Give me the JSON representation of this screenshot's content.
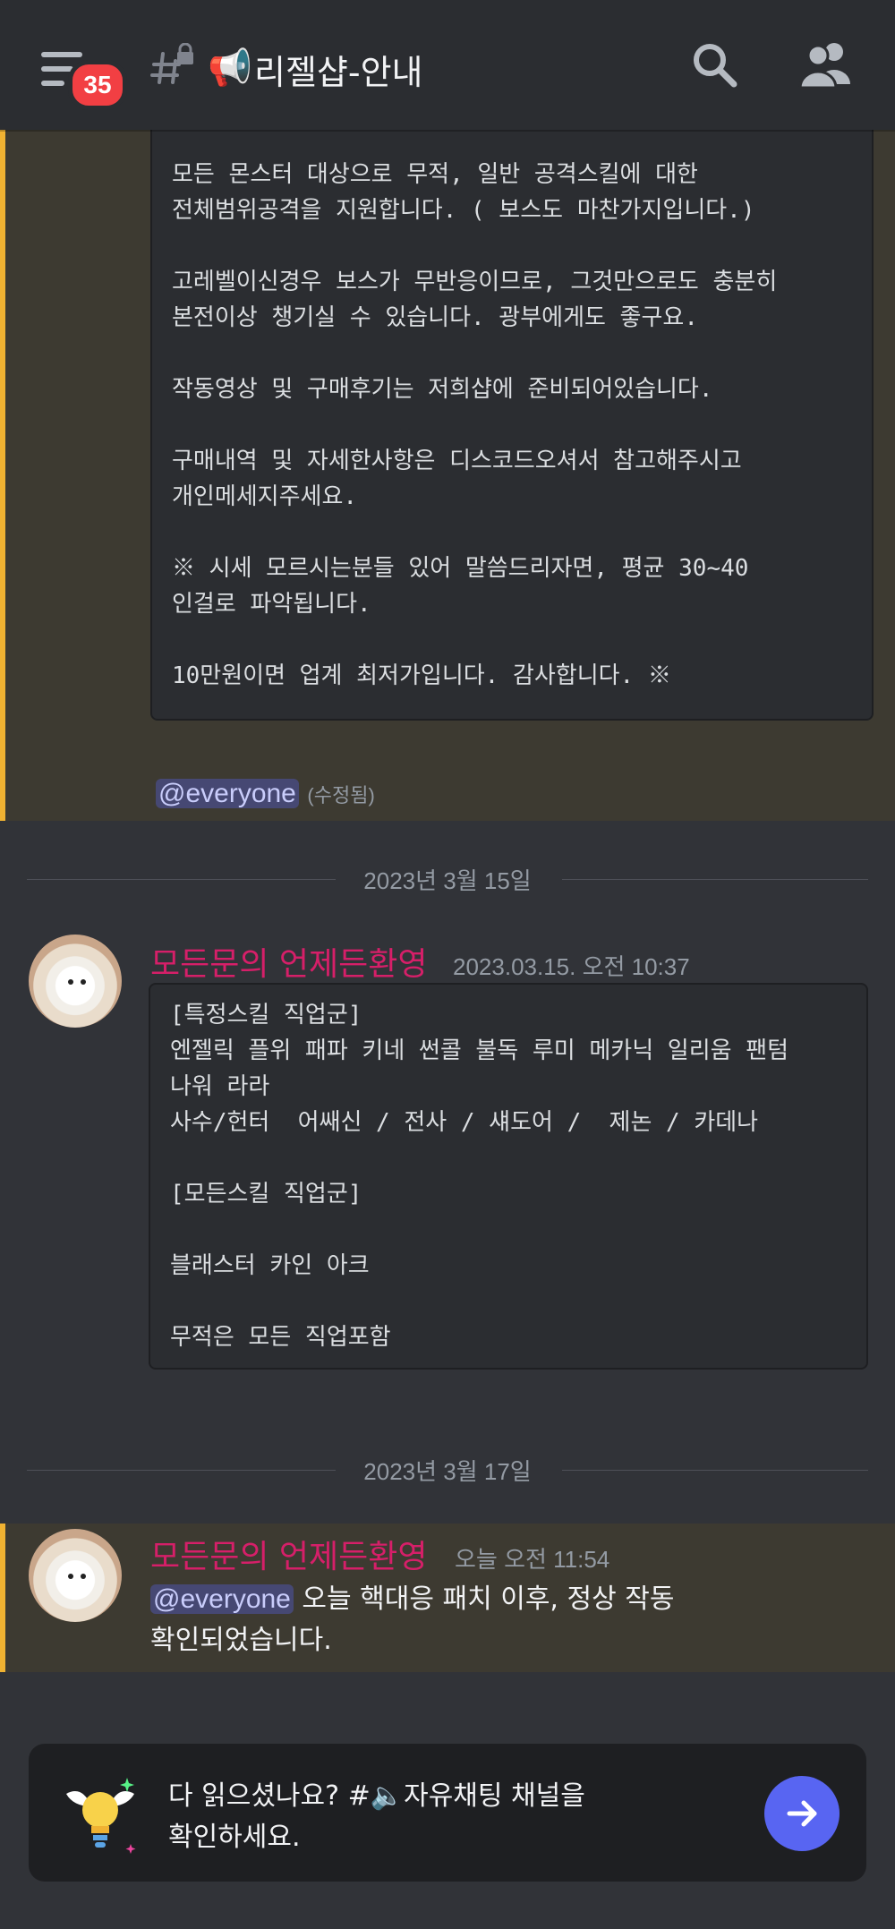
{
  "header": {
    "badge_count": "35",
    "channel_emoji": "📢",
    "channel_name": "리젤샵-안내",
    "icons": [
      "menu-icon",
      "locked-hash-icon",
      "search-icon",
      "members-icon"
    ]
  },
  "announcement": {
    "code_text": "모든 몬스터 대상으로 무적, 일반 공격스킬에 대한\n전체범위공격을 지원합니다. ( 보스도 마찬가지입니다.)\n\n고레벨이신경우 보스가 무반응이므로, 그것만으로도 충분히\n본전이상 챙기실 수 있습니다. 광부에게도 좋구요.\n\n작동영상 및 구매후기는 저희샵에 준비되어있습니다.\n\n구매내역 및 자세한사항은 디스코드오셔서 참고해주시고\n개인메세지주세요.\n\n※ 시세 모르시는분들 있어 말씀드리자면, 평균 30~40\n인걸로 파악됩니다.\n\n10만원이면 업계 최저가입니다. 감사합니다. ※",
    "mention": "@everyone",
    "edited": "(수정됨)"
  },
  "dividers": {
    "first": "2023년 3월 15일",
    "second": "2023년 3월 17일"
  },
  "message1": {
    "author": "모든문의 언제든환영",
    "timestamp": "2023.03.15. 오전 10:37",
    "code_text": "[특정스킬 직업군]\n엔젤릭 플위 패파 키네 썬콜 불독 루미 메카닉 일리움 팬텀\n나워 라라\n사수/헌터  어쌔신 / 전사 / 섀도어 /  제논 / 카데나\n\n[모든스킬 직업군]\n\n블래스터 카인 아크\n\n무적은 모든 직업포함"
  },
  "message2": {
    "author": "모든문의 언제든환영",
    "timestamp": "오늘 오전 11:54",
    "mention": "@everyone",
    "line1": " 오늘 핵대응 패치 이후, 정상 작동",
    "line2": "확인되었습니다."
  },
  "prompt": {
    "line1_before": "다 읽으셨나요? #",
    "line1_emoji": "🔈",
    "line1_after": "자유채팅 채널을",
    "line2": "확인하세요.",
    "button_icon": "arrow-right-icon"
  },
  "colors": {
    "background": "#313338",
    "header": "#2b2d31",
    "highlight": "#3d3a31",
    "highlight_bar": "#f0b232",
    "author": "#d61f69",
    "accent": "#5865f2",
    "badge": "#f23f43"
  }
}
